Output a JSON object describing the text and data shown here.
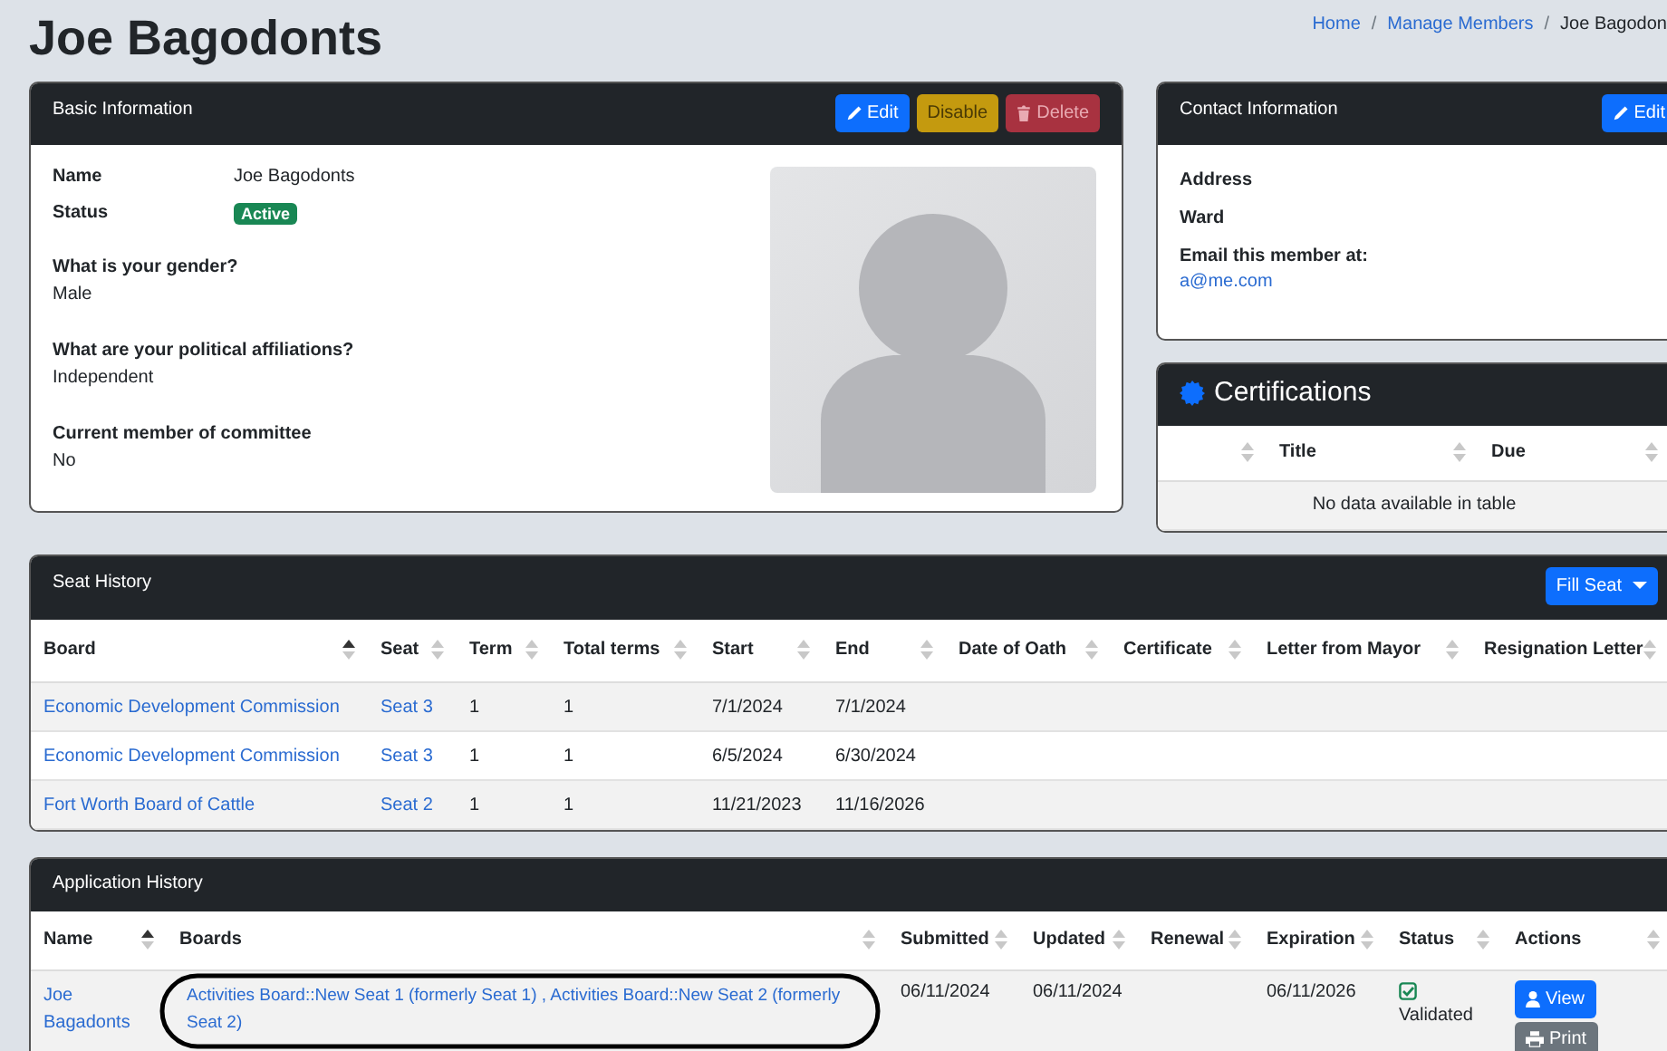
{
  "page_title": "Joe Bagodonts",
  "breadcrumb": [
    {
      "label": "Home",
      "kind": "link"
    },
    {
      "label": "/",
      "kind": "separator"
    },
    {
      "label": "Manage Members",
      "kind": "link"
    },
    {
      "label": "/",
      "kind": "separator"
    },
    {
      "label": "Joe Bagodon",
      "kind": "current"
    }
  ],
  "basic_information": {
    "title": "Basic Information",
    "buttons": [
      {
        "label": "Edit",
        "kind": "edit"
      },
      {
        "label": "Disable",
        "kind": "disable"
      },
      {
        "label": "Delete",
        "kind": "delete"
      }
    ],
    "name_label": "Name",
    "name": "Joe Bagodonts",
    "status_label": "Status",
    "status": "Active",
    "questions": [
      {
        "question": "What is your gender?",
        "answer": "Male"
      },
      {
        "question": "What are your political affiliations?",
        "answer": "Independent"
      },
      {
        "question": "Current member of committee",
        "answer": "No"
      }
    ]
  },
  "contact_information": {
    "title": "Contact Information",
    "button": "Edit",
    "fields": [
      {
        "label": "Address"
      },
      {
        "label": "Ward"
      },
      {
        "label": "Email this member at:",
        "value": "a@me.com"
      }
    ]
  },
  "certifications": {
    "title": "Certifications",
    "columns": [
      {
        "sorted": false
      },
      {
        "label": "Title",
        "sorted": false
      },
      {
        "label": "Due",
        "sorted": false
      }
    ],
    "empty_message": "No data available in table"
  },
  "seat_history": {
    "title": "Seat History",
    "button": "Fill Seat",
    "columns": [
      {
        "label": "Board",
        "sorted": true
      },
      {
        "label": "Seat",
        "sorted": false
      },
      {
        "label": "Term",
        "sorted": false
      },
      {
        "label": "Total terms",
        "sorted": false
      },
      {
        "label": "Start",
        "sorted": false
      },
      {
        "label": "End",
        "sorted": false
      },
      {
        "label": "Date of Oath",
        "sorted": false
      },
      {
        "label": "Certificate",
        "sorted": false
      },
      {
        "label": "Letter from Mayor",
        "sorted": false
      },
      {
        "label": "Resignation Letter",
        "sorted": false
      }
    ],
    "rows": [
      {
        "board": "Economic Development Commission",
        "seat": "Seat 3",
        "term": "1",
        "total_terms": "1",
        "start": "7/1/2024",
        "end": "7/1/2024"
      },
      {
        "board": "Economic Development Commission",
        "seat": "Seat 3",
        "term": "1",
        "total_terms": "1",
        "start": "6/5/2024",
        "end": "6/30/2024"
      },
      {
        "board": "Fort Worth Board of Cattle",
        "seat": "Seat 2",
        "term": "1",
        "total_terms": "1",
        "start": "11/21/2023",
        "end": "11/16/2026"
      }
    ]
  },
  "application_history": {
    "title": "Application History",
    "columns": [
      {
        "label": "Name",
        "sorted": true
      },
      {
        "label": "Boards",
        "sorted": false
      },
      {
        "label": "Submitted",
        "sorted": false
      },
      {
        "label": "Updated",
        "sorted": false
      },
      {
        "label": "Renewal",
        "sorted": false
      },
      {
        "label": "Expiration",
        "sorted": false
      },
      {
        "label": "Status",
        "sorted": false
      },
      {
        "label": "Actions",
        "sorted": false
      }
    ],
    "rows": [
      {
        "name": "Joe Bagadonts",
        "boards": "Activities Board::New Seat 1 (formerly Seat 1) , Activities Board::New Seat 2 (formerly Seat 2)",
        "submitted": "06/11/2024",
        "updated": "06/11/2024",
        "expiration": "06/11/2026",
        "status": "Validated",
        "validated": true,
        "actions": [
          {
            "label": "View",
            "kind": "view"
          },
          {
            "label": "Print",
            "kind": "print"
          }
        ]
      }
    ]
  }
}
